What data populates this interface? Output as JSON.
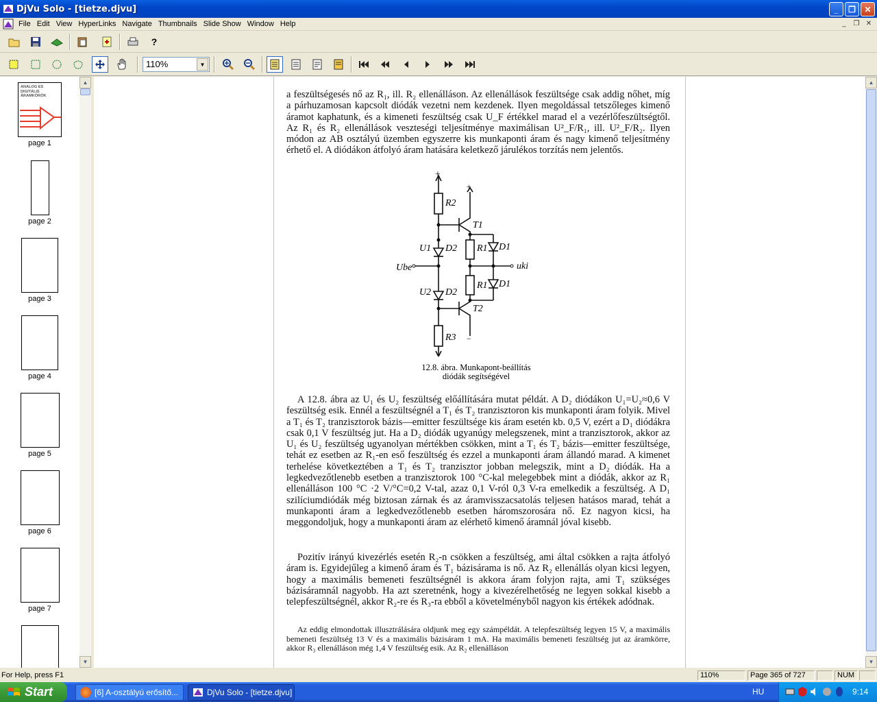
{
  "window": {
    "title": "DjVu Solo - [tietze.djvu]"
  },
  "menu": [
    "File",
    "Edit",
    "View",
    "HyperLinks",
    "Navigate",
    "Thumbnails",
    "Slide Show",
    "Window",
    "Help"
  ],
  "toolbar": {
    "zoom_value": "110%"
  },
  "thumbnails": [
    {
      "label": "page 1"
    },
    {
      "label": "page 2"
    },
    {
      "label": "page 3"
    },
    {
      "label": "page 4"
    },
    {
      "label": "page 5"
    },
    {
      "label": "page 6"
    },
    {
      "label": "page 7"
    }
  ],
  "thumb1_text": "ANALÓG ÉS DIGITÁLIS ÁRAMKÖRÖK",
  "document": {
    "para1": "a feszültségesés nő az R₁, ill. R₂ ellenálláson. Az ellenállások feszültsége csak addig nőhet, míg a párhuzamosan kapcsolt diódák vezetni nem kezdenek. Ilyen megoldással tetszőleges kimenő áramot kaphatunk, és a kimeneti feszültség csak U_F értékkel marad el a vezérlőfeszültségtől. Az R₁ és R₂ ellenállások veszteségi teljesítménye maximálisan U²_F/R₁, ill. U²_F/R₂. Ilyen módon az AB osztályú üzemben egyszerre kis munkaponti áram és nagy kimenő teljesítmény érhető el. A diódákon átfolyó áram hatására keletkező járulékos torzítás nem jelentős.",
    "caption_line1": "12.8. ábra. Munkapont-beállítás",
    "caption_line2": "diódák segítségével",
    "para2": "A 12.8. ábra az U₁ és U₂ feszültség előállítására mutat példát. A D₂ diódákon U₁=U₂≈0,6 V feszültség esik. Ennél a feszültségnél a T₁ és T₂ tranzisztoron kis munkaponti áram folyik. Mivel a T₁ és T₂ tranzisztorok bázis—emitter feszültsége kis áram esetén kb. 0,5 V, ezért a D₁ diódákra csak 0,1 V feszültség jut. Ha a D₂ diódák ugyanúgy melegszenek, mint a tranzisztorok, akkor az U₁ és U₂ feszültség ugyanolyan mértékben csökken, mint a T₁ és T₂ bázis—emitter feszültsége, tehát ez esetben az R₁-en eső feszültség és ezzel a munkaponti áram állandó marad. A kimenet terhelése következtében a T₁ és T₂ tranzisztor jobban melegszik, mint a D₂ diódák. Ha a legkedvezőtlenebb esetben a tranzisztorok 100 °C-kal melegebbek mint a diódák, akkor az R₁ ellenálláson 100 °C ·2 V/°C=0,2 V-tal, azaz 0,1 V-ról 0,3 V-ra emelkedik a feszültség. A D₁ szilíciumdiódák még biztosan zárnak és az áramvisszacsatolás teljesen hatásos marad, tehát a munkaponti áram a legkedvezőtlenebb esetben háromszorosára nő. Ez nagyon kicsi, ha meggondoljuk, hogy a munkaponti áram az elérhető kimenő áramnál jóval kisebb.",
    "para3": "Pozitív irányú kivezérlés esetén R₂-n csökken a feszültség, ami által csökken a rajta átfolyó áram is. Egyidejűleg a kimenő áram és T₁ bázisárama is nő. Az R₂ ellenállás olyan kicsi legyen, hogy a maximális bemeneti feszültségnél is akkora áram folyjon rajta, ami T₁ szükséges bázisáramnál nagyobb. Ha azt szeretnénk, hogy a kivezérelhetőség ne legyen sokkal kisebb a telepfeszültségnél, akkor R₂-re és R₃-ra ebből a követelményből nagyon kis értékek adódnak.",
    "para4": "Az eddig elmondottak illusztrálására oldjunk meg egy számpéldát. A telepfeszültség legyen 15 V, a maximális bemeneti feszültség 13 V és a maximális bázisáram 1 mA. Ha maximális bemeneti feszültség jut az áramkörre, akkor R₃ ellenálláson még 1,4 V feszültség esik. Az R₂ ellenálláson",
    "circuit_labels": {
      "plus": "+",
      "plus2": "+",
      "minus": "−",
      "minus2": "−",
      "r2_top": "R2",
      "r3": "R3",
      "r1a": "R1",
      "r1b": "R1",
      "t1": "T1",
      "t2": "T2",
      "d2a": "D2",
      "d2b": "D2",
      "d1a": "D1",
      "d1b": "D1",
      "u1": "U1",
      "u2": "U2",
      "ube": "Ube",
      "uki": "uki"
    }
  },
  "status": {
    "help": "For Help, press F1",
    "zoom": "110%",
    "page": "Page 365 of 727",
    "num": "NUM"
  },
  "taskbar": {
    "start": "Start",
    "items": [
      "[6] A-osztályú erősítő...",
      "DjVu Solo - [tietze.djvu]"
    ],
    "lang": "HU",
    "time": "9:14"
  }
}
